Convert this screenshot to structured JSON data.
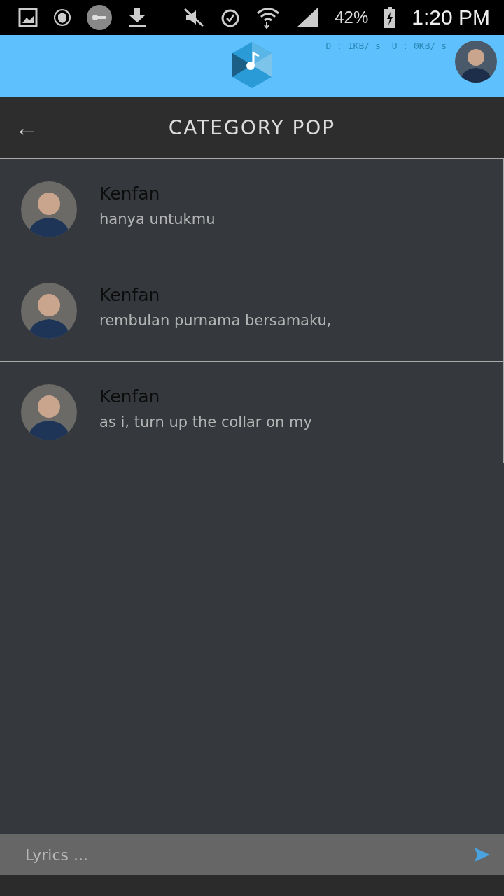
{
  "status_bar": {
    "battery": "42%",
    "time": "1:20 PM"
  },
  "header": {
    "download_speed": "D : 1KB/ s",
    "upload_speed": "U : 0KB/ s"
  },
  "title_bar": {
    "back": "←",
    "title": "CATEGORY POP"
  },
  "songs": [
    {
      "artist": "Kenfan",
      "lyric": "hanya untukmu"
    },
    {
      "artist": "Kenfan",
      "lyric": "rembulan purnama bersamaku,"
    },
    {
      "artist": "Kenfan",
      "lyric": "as i, turn up the collar on my"
    }
  ],
  "lyrics_input": {
    "placeholder": "Lyrics ..."
  }
}
